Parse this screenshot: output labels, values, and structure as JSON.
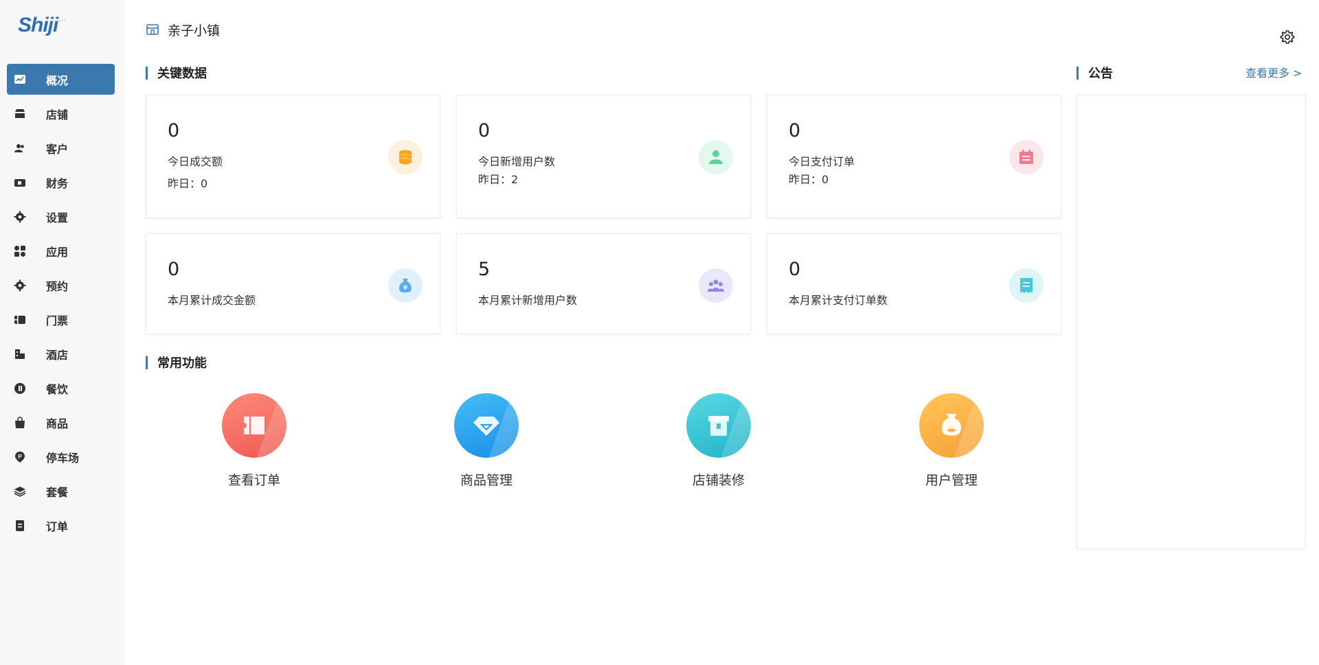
{
  "brand": {
    "logo_text": "Shiji",
    "accent": "#3b78ae"
  },
  "header": {
    "shop_name": "亲子小镇"
  },
  "sidebar": {
    "items": [
      {
        "label": "概况",
        "icon": "chart-icon",
        "active": true
      },
      {
        "label": "店铺",
        "icon": "store-icon"
      },
      {
        "label": "客户",
        "icon": "users-icon"
      },
      {
        "label": "财务",
        "icon": "wallet-icon"
      },
      {
        "label": "设置",
        "icon": "gear-icon"
      },
      {
        "label": "应用",
        "icon": "apps-icon"
      },
      {
        "label": "预约",
        "icon": "gear-icon"
      },
      {
        "label": "门票",
        "icon": "ticket-icon"
      },
      {
        "label": "酒店",
        "icon": "hotel-icon"
      },
      {
        "label": "餐饮",
        "icon": "dining-icon"
      },
      {
        "label": "商品",
        "icon": "bag-icon"
      },
      {
        "label": "停车场",
        "icon": "parking-icon"
      },
      {
        "label": "套餐",
        "icon": "layers-icon"
      },
      {
        "label": "订单",
        "icon": "order-icon"
      }
    ]
  },
  "key_data": {
    "title": "关键数据",
    "cards": [
      {
        "value": "0",
        "label": "今日成交额",
        "sub": "昨日：0",
        "icon": "coins-icon",
        "icon_bg": "#fdf1de",
        "icon_color": "#f5a623"
      },
      {
        "value": "0",
        "label": "今日新增用户数",
        "sub": "昨日：2",
        "icon": "user-icon",
        "icon_bg": "#e3f7ee",
        "icon_color": "#5cd39a"
      },
      {
        "value": "0",
        "label": "今日支付订单",
        "sub": "昨日：0",
        "icon": "calendar-icon",
        "icon_bg": "#fde6ea",
        "icon_color": "#f27a92"
      },
      {
        "value": "0",
        "label": "本月累计成交金额",
        "sub": "",
        "icon": "money-bag-icon",
        "icon_bg": "#e1f0fd",
        "icon_color": "#5aaef0"
      },
      {
        "value": "5",
        "label": "本月累计新增用户数",
        "sub": "",
        "icon": "group-icon",
        "icon_bg": "#e9e8fb",
        "icon_color": "#8e89e8"
      },
      {
        "value": "0",
        "label": "本月累计支付订单数",
        "sub": "",
        "icon": "receipt-icon",
        "icon_bg": "#def5f8",
        "icon_color": "#4cc7d8"
      }
    ]
  },
  "functions": {
    "title": "常用功能",
    "items": [
      {
        "label": "查看订单",
        "icon": "ticket-icon",
        "color_from": "#ff8a7a",
        "color_to": "#ee5a52"
      },
      {
        "label": "商品管理",
        "icon": "diamond-icon",
        "color_from": "#45bdf5",
        "color_to": "#1a8fe8"
      },
      {
        "label": "店铺装修",
        "icon": "box-icon",
        "color_from": "#5ad9e3",
        "color_to": "#1fb3c9"
      },
      {
        "label": "用户管理",
        "icon": "user-bag-icon",
        "color_from": "#ffc659",
        "color_to": "#f7a035"
      }
    ]
  },
  "notice": {
    "title": "公告",
    "more": "查看更多 >"
  }
}
